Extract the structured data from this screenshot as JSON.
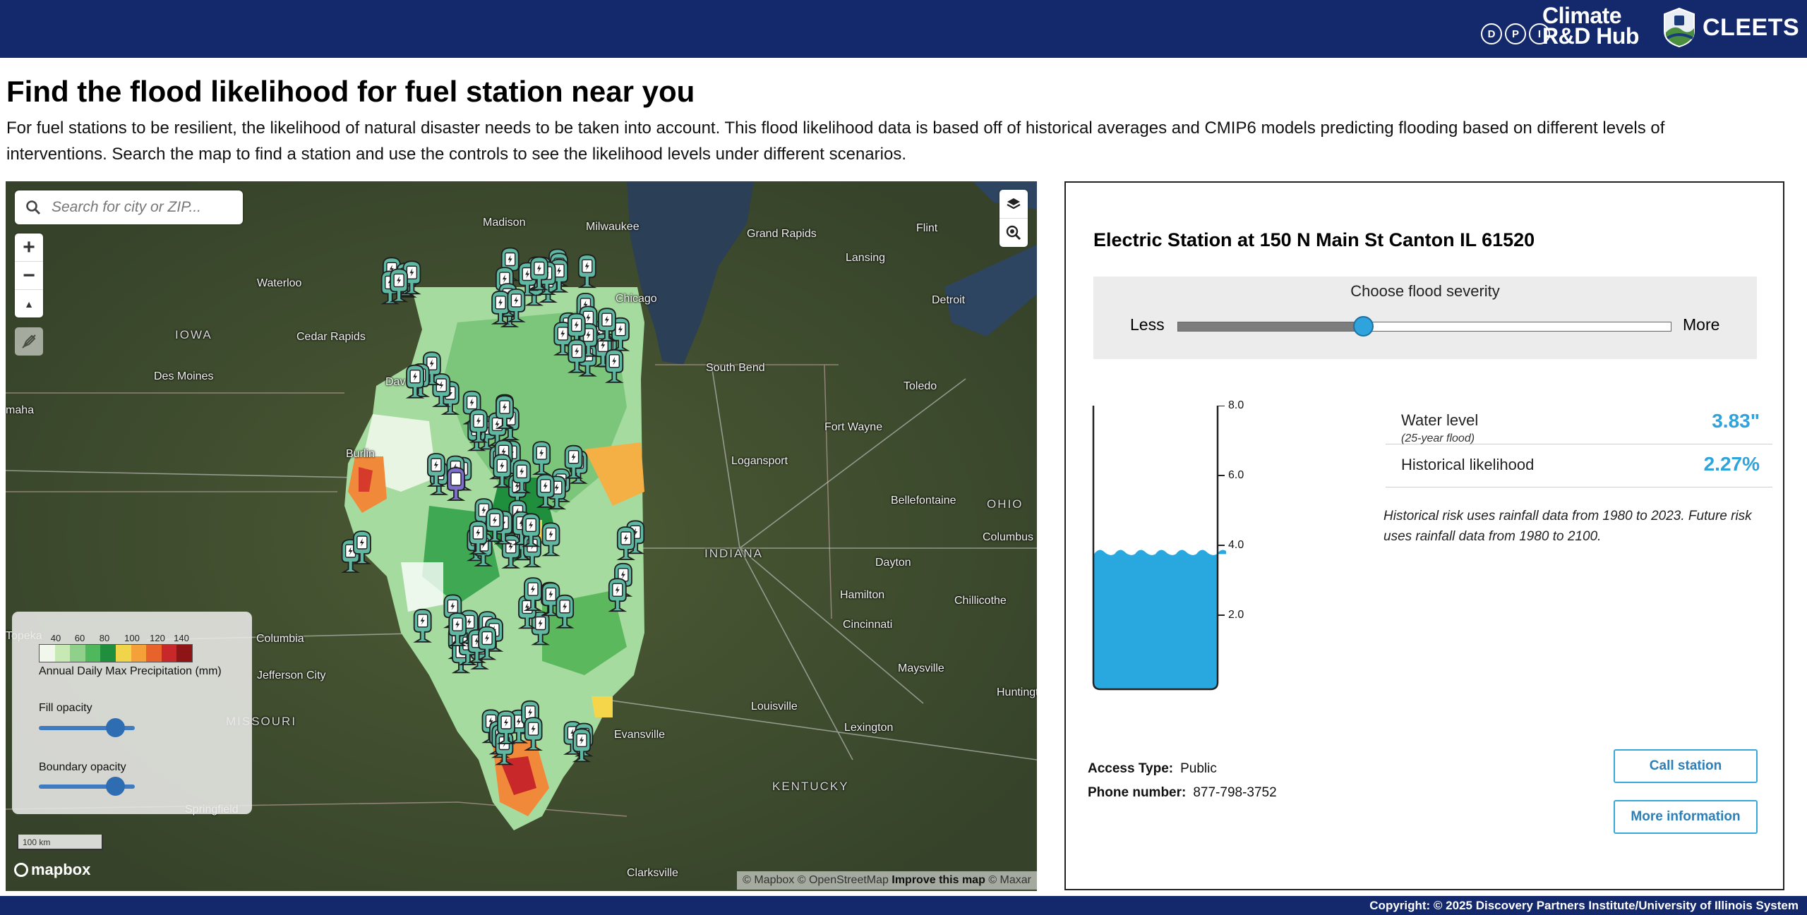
{
  "header": {
    "logo_dpi_letters": [
      "D",
      "P",
      "I"
    ],
    "logo_hub_line1": "Climate",
    "logo_hub_line2": "R&D Hub",
    "logo_cleets": "CLEETS",
    "background_color": "#13296b"
  },
  "page": {
    "title": "Find the flood likelihood for fuel station near you",
    "intro": "For fuel stations to be resilient, the likelihood of natural disaster needs to be taken into account. This flood likelihood data is based off of historical averages and CMIP6 models predicting flooding based on different levels of interventions. Search the map to find a station and use the controls to see the likelihood levels under different scenarios."
  },
  "map": {
    "search_placeholder": "Search for city or ZIP...",
    "zoom_in": "+",
    "zoom_out": "−",
    "compass": "▲",
    "state_labels": {
      "iowa": "IOWA",
      "indiana": "INDIANA",
      "ohio": "OHIO",
      "missouri": "MISSOURI",
      "kentucky": "KENTUCKY"
    },
    "city_labels": {
      "madison": "Madison",
      "milwaukee": "Milwaukee",
      "grand_rapids": "Grand Rapids",
      "flint": "Flint",
      "lansing": "Lansing",
      "detroit": "Detroit",
      "waterloo": "Waterloo",
      "cedar_rapids": "Cedar Rapids",
      "des_moines": "Des Moines",
      "south_bend": "South Bend",
      "toledo": "Toledo",
      "fort_wayne": "Fort Wayne",
      "logansport": "Logansport",
      "burlington": "Burlin",
      "bellefontaine": "Bellefontaine",
      "columbus_oh": "Columbus",
      "dayton": "Dayton",
      "hamilton": "Hamilton",
      "chillicothe": "Chillicothe",
      "cincinnati": "Cincinnati",
      "columbia": "Columbia",
      "jefferson_city": "Jefferson City",
      "evansville": "Evansville",
      "louisville": "Louisville",
      "lexington": "Lexington",
      "maysville": "Maysville",
      "clarksville": "Clarksville",
      "huntington": "Huntingt",
      "springfield": "Springfield",
      "topeka": "Topeka",
      "omaha": "maha",
      "davenport": "Dav",
      "chicago": "Chicago"
    },
    "legend": {
      "ticks": [
        "40",
        "60",
        "80",
        "100",
        "120",
        "140"
      ],
      "colors": [
        "#f1f7ec",
        "#c7e9b4",
        "#8fd08a",
        "#4fb85c",
        "#1f8f3e",
        "#f0d54a",
        "#f5a13a",
        "#e8632b",
        "#c9282a",
        "#8e1416"
      ],
      "label": "Annual Daily Max Precipitation (mm)",
      "fill_opacity_label": "Fill opacity",
      "boundary_opacity_label": "Boundary opacity",
      "fill_opacity_value": 0.8,
      "boundary_opacity_value": 0.8
    },
    "scale_label": "100 km",
    "mapbox_label": "mapbox",
    "attribution_prefix": "© Mapbox © OpenStreetMap",
    "attribution_improve": "Improve this map",
    "attribution_suffix": "© Maxar"
  },
  "station": {
    "title": "Electric Station at 150 N Main St Canton IL 61520",
    "severity_label": "Choose flood severity",
    "severity_less": "Less",
    "severity_more": "More",
    "severity_value": 0.375,
    "gauge_ticks": [
      "8.0",
      "6.0",
      "4.0",
      "2.0"
    ],
    "gauge_max": 8.0,
    "water_level_value": 3.83,
    "water_level_label": "Water level",
    "water_level_sub": "(25-year flood)",
    "water_level": "3.83\"",
    "historical_label": "Historical likelihood",
    "historical_value": "2.27%",
    "note": "Historical risk uses rainfall data from 1980 to 2023. Future risk uses rainfall data from 1980 to 2100.",
    "access_label": "Access Type:",
    "access_value": "Public",
    "phone_label": "Phone number:",
    "phone_value": "877-798-3752",
    "call_button": "Call station",
    "more_button": "More information",
    "accent_color": "#2ea3dc"
  },
  "footer": {
    "copyright": "Copyright: © 2025 Discovery Partners Institute/University of Illinois System"
  }
}
